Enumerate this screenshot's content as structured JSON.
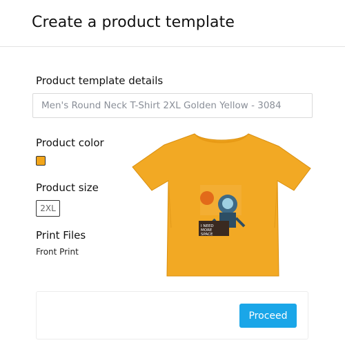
{
  "header": {
    "title": "Create a product template"
  },
  "details": {
    "label": "Product template details",
    "value": "Men's Round Neck T-Shirt 2XL Golden Yellow - 3084"
  },
  "color": {
    "label": "Product color",
    "swatch_color": "#f2a51a"
  },
  "size": {
    "label": "Product size",
    "selected": "2XL"
  },
  "print_files": {
    "label": "Print Files",
    "item": "Front Print"
  },
  "preview": {
    "shirt_color": "#f2a924",
    "graphic_text": "I NEED MORE SPACE"
  },
  "footer": {
    "proceed_label": "Proceed"
  },
  "colors": {
    "accent": "#1aa6e8",
    "border": "#d9d9d9"
  }
}
